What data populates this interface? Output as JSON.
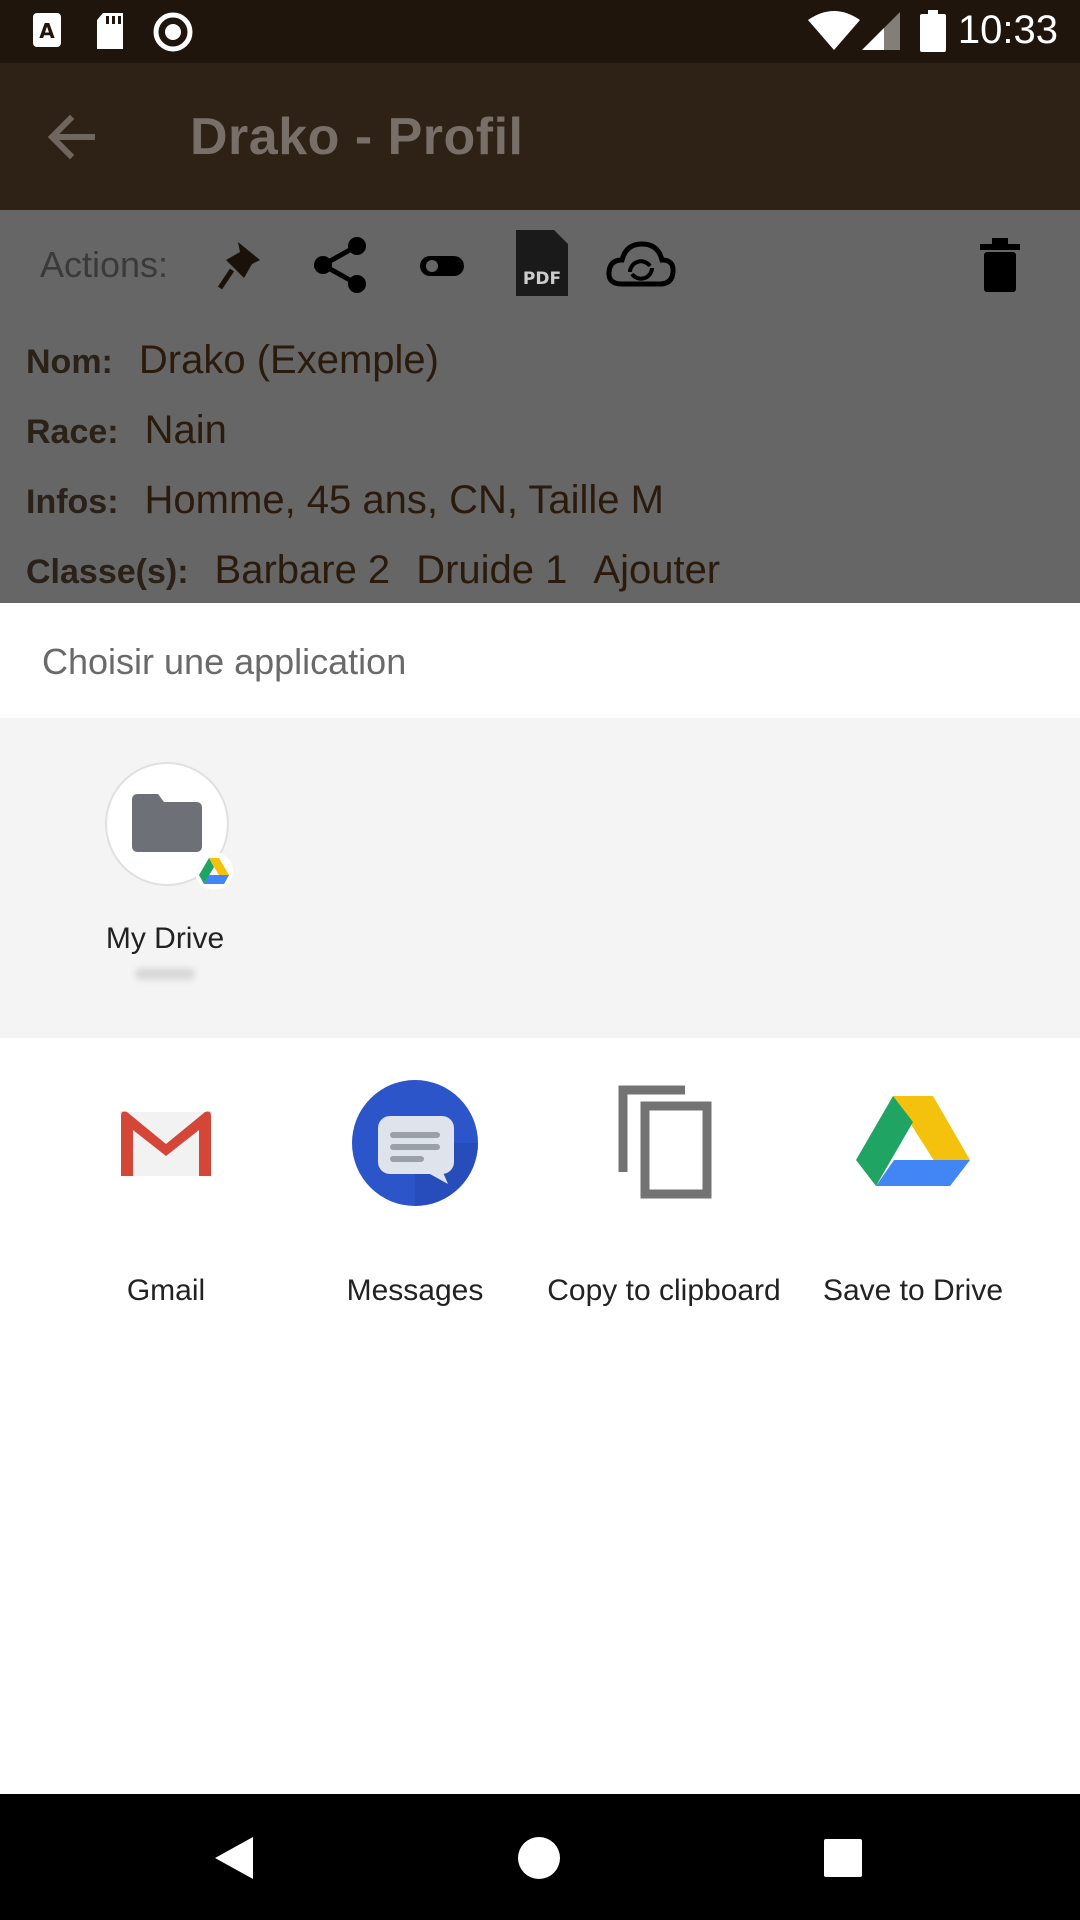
{
  "status_bar": {
    "time": "10:33"
  },
  "app_bar": {
    "title": "Drako - Profil"
  },
  "actions": {
    "label": "Actions:"
  },
  "profile": {
    "nom_label": "Nom:",
    "nom_value": "Drako (Exemple)",
    "race_label": "Race:",
    "race_value": "Nain",
    "infos_label": "Infos:",
    "infos_value": "Homme, 45 ans, CN, Taille M",
    "classes_label": "Classe(s):",
    "class1": "Barbare 2",
    "class2": "Druide 1",
    "add_class": "Ajouter"
  },
  "chooser": {
    "title": "Choisir une application",
    "direct_share": {
      "label": "My Drive"
    },
    "apps": [
      {
        "label": "Gmail",
        "icon": "gmail-icon"
      },
      {
        "label": "Messages",
        "icon": "messages-icon"
      },
      {
        "label": "Copy to clipboard",
        "icon": "copy-icon"
      },
      {
        "label": "Save to Drive",
        "icon": "google-drive-icon"
      }
    ]
  },
  "colors": {
    "status_bar": "#1f150c",
    "app_bar": "#2e2115",
    "scrim": "#666666",
    "messages_blue": "#2b55c9"
  }
}
